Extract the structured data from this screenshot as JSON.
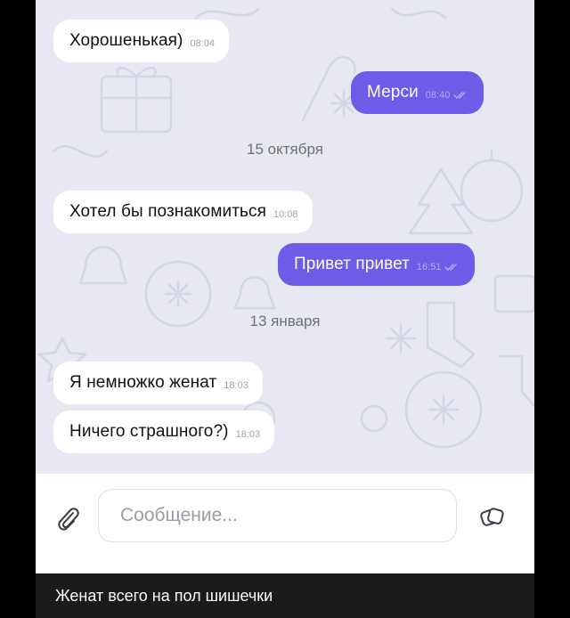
{
  "chat": {
    "messages": [
      {
        "text": "Хорошенькая)",
        "time": "08:04",
        "direction": "incoming"
      },
      {
        "text": "Мерси",
        "time": "08:40",
        "direction": "outgoing",
        "status": "read"
      },
      {
        "text": "Хотел бы познакомиться",
        "time": "10:08",
        "direction": "incoming"
      },
      {
        "text": "Привет привет",
        "time": "16:51",
        "direction": "outgoing",
        "status": "read"
      },
      {
        "text": "Я немножко женат",
        "time": "18:03",
        "direction": "incoming"
      },
      {
        "text": "Ничего страшного?)",
        "time": "18:03",
        "direction": "incoming"
      }
    ],
    "date_separators": [
      "15 октября",
      "13 января"
    ]
  },
  "composer": {
    "placeholder": "Сообщение...",
    "attach_icon": "paperclip-icon",
    "sticker_icon": "sticker-icon"
  },
  "caption": "Женат всего на пол шишечки",
  "colors": {
    "outgoing_bubble": "#6c5ce7",
    "incoming_bubble": "#ffffff",
    "chat_background": "#e7e8f2"
  }
}
